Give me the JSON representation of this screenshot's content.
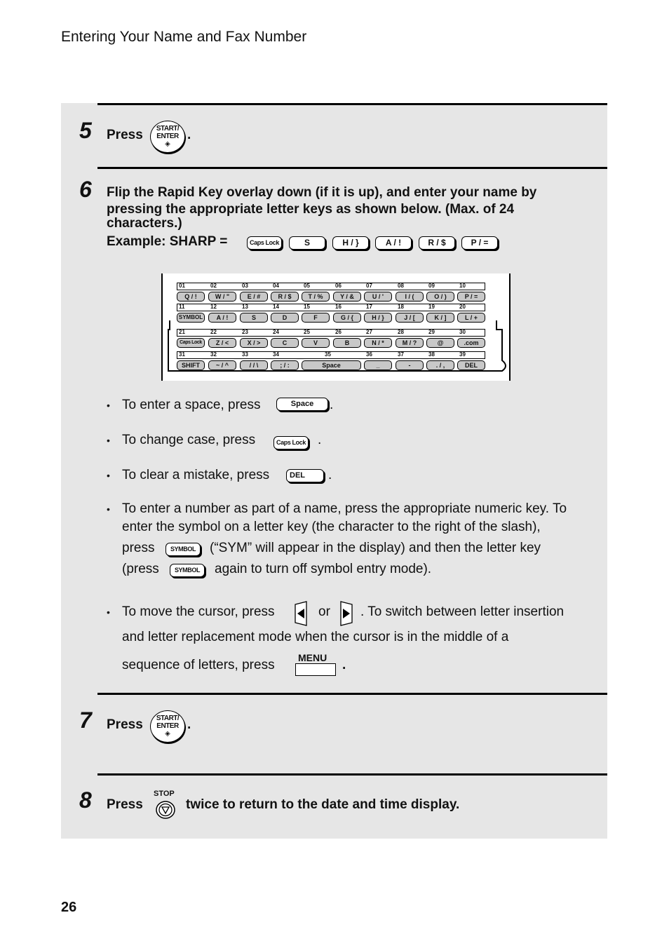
{
  "header": {
    "title": "Entering Your Name and Fax Number"
  },
  "page_number": "26",
  "steps": {
    "s5": {
      "num": "5",
      "press": "Press",
      "period": "."
    },
    "s6": {
      "num": "6",
      "line1": "Flip the Rapid Key overlay down (if it is up), and enter your name by",
      "line2": "pressing the appropriate letter keys as shown below. (Max. of 24",
      "line3": "characters.)",
      "example_label": "Example: SHARP =",
      "example_keys": [
        "Caps Lock",
        "S",
        "H / }",
        "A / !",
        "R / $",
        "P / ="
      ]
    },
    "s7": {
      "num": "7",
      "press": "Press",
      "period": "."
    },
    "s8": {
      "num": "8",
      "press": "Press",
      "rest": "twice to return to the date and time display."
    }
  },
  "buttons": {
    "start_enter": {
      "line1": "START/",
      "line2": "ENTER",
      "symbol": "◈"
    },
    "stop": {
      "label": "STOP",
      "symbol": "▽"
    },
    "space": "Space",
    "caps_lock": "Caps Lock",
    "del": "DEL",
    "symbol": "SYMBOL",
    "menu": "MENU",
    "left_arrow": "◀",
    "right_arrow": "▶"
  },
  "keyboard": {
    "rows": [
      {
        "nums": [
          "01",
          "02",
          "03",
          "04",
          "05",
          "06",
          "07",
          "08",
          "09",
          "10"
        ],
        "keys": [
          "Q / !",
          "W / \"",
          "E / #",
          "R / $",
          "T / %",
          "Y / &",
          "U / '",
          "I / (",
          "O / )",
          "P / ="
        ]
      },
      {
        "nums": [
          "11",
          "12",
          "13",
          "14",
          "15",
          "16",
          "17",
          "18",
          "19",
          "20"
        ],
        "keys": [
          "SYMBOL",
          "A / !",
          "S",
          "D",
          "F",
          "G / {",
          "H / }",
          "J / [",
          "K / ]",
          "L / +"
        ]
      },
      {
        "nums": [
          "21",
          "22",
          "23",
          "24",
          "25",
          "26",
          "27",
          "28",
          "29",
          "30"
        ],
        "keys": [
          "Caps Lock",
          "Z / <",
          "X / >",
          "C",
          "V",
          "B",
          "N / *",
          "M / ?",
          "@",
          ".com"
        ]
      },
      {
        "nums": [
          "31",
          "32",
          "33",
          "34",
          "35",
          "36",
          "37",
          "38",
          "39"
        ],
        "keys": [
          "SHIFT",
          "~ / ^",
          "/ / \\",
          "; / :",
          "Space",
          "_",
          "-",
          ". / ,",
          "DEL"
        ]
      }
    ]
  },
  "bullets": {
    "b1": {
      "text": "To enter a space, press",
      "end": "."
    },
    "b2": {
      "text": "To change case, press",
      "end": "."
    },
    "b3": {
      "text": "To clear a mistake, press",
      "end": "."
    },
    "b4": {
      "line1": "To enter a number as part of a name, press the appropriate numeric key. To",
      "line2": "enter the symbol on a letter key (the character to the right of the slash),",
      "line3a": "press",
      "line3b": "(“SYM” will appear in the display) and then the letter key",
      "line4a": "(press",
      "line4b": "again to turn off symbol entry mode)."
    },
    "b5": {
      "line1a": "To move the cursor, press",
      "line1b": "or",
      "line1c": ". To switch between letter insertion",
      "line2": "and letter replacement mode when the cursor is in the middle of a",
      "line3a": "sequence of letters, press",
      "line3b": "."
    },
    "glyph": "•"
  }
}
